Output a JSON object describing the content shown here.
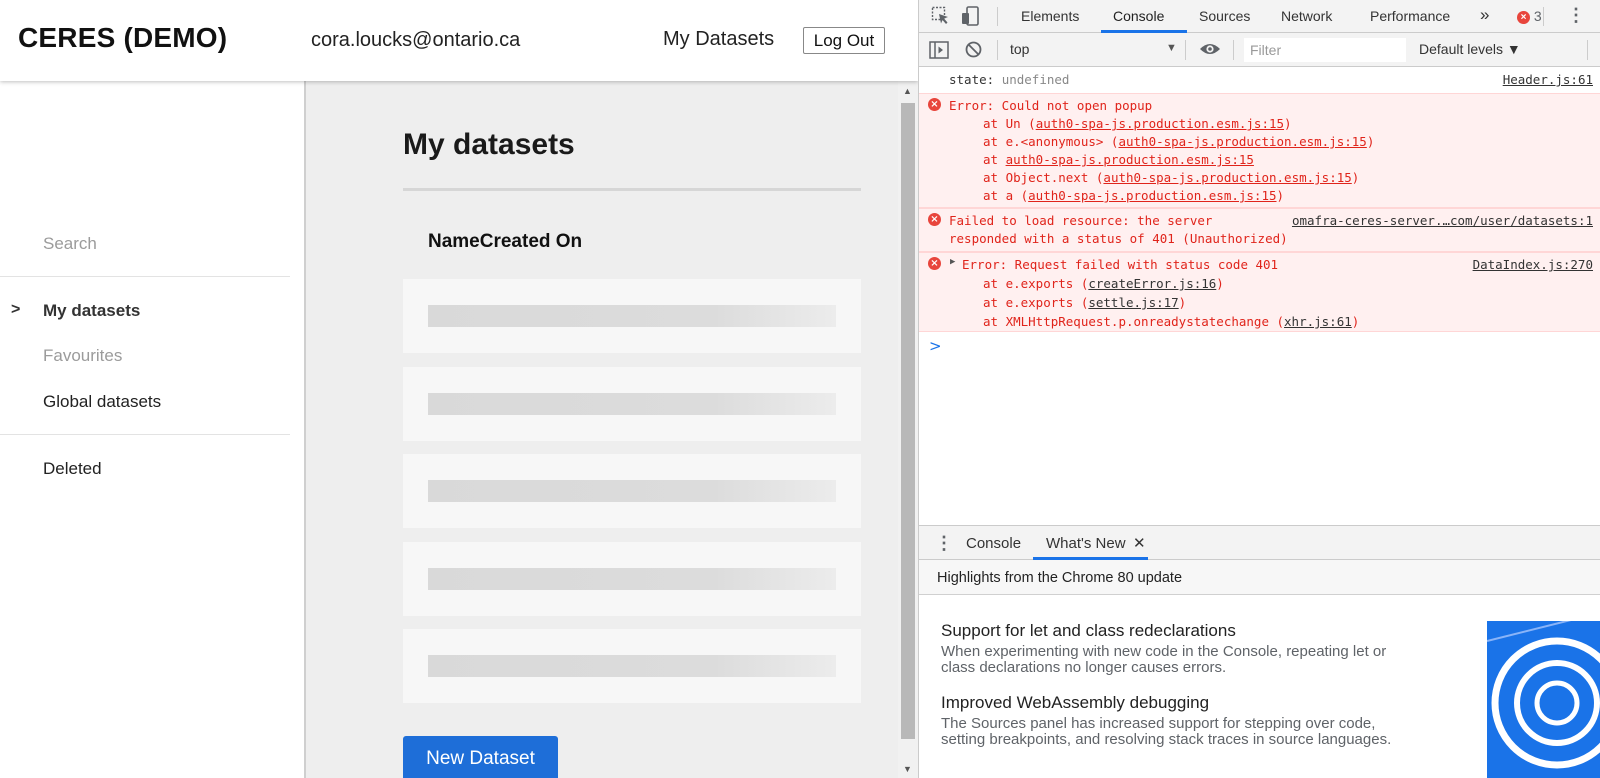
{
  "app": {
    "brand": "CERES (DEMO)",
    "user_email": "cora.loucks@ontario.ca",
    "nav_my_datasets": "My Datasets",
    "logout_label": "Log Out",
    "sidebar": {
      "search_label": "Search",
      "active_marker": ">",
      "items": [
        {
          "label": "My datasets"
        },
        {
          "label": "Favourites"
        },
        {
          "label": "Global datasets"
        },
        {
          "label": "Deleted"
        }
      ]
    },
    "main": {
      "title": "My datasets",
      "table_header": "NameCreated On",
      "new_button_label": "New Dataset"
    },
    "accent_color": "#1e6ed8"
  },
  "devtools": {
    "tabs": [
      "Elements",
      "Console",
      "Sources",
      "Network",
      "Performance"
    ],
    "more_tabs_glyph": "»",
    "error_count": "3",
    "context": "top",
    "filter_placeholder": "Filter",
    "levels_label": "Default levels ▼",
    "console": {
      "state_line": {
        "key": "state:",
        "value": "undefined",
        "source": "Header.js:61"
      },
      "error1": {
        "message": "Error: Could not open popup",
        "stack": [
          {
            "prefix": "at Un (",
            "link": "auth0-spa-js.production.esm.js:15",
            "suffix": ")"
          },
          {
            "prefix": "at e.<anonymous> (",
            "link": "auth0-spa-js.production.esm.js:15",
            "suffix": ")"
          },
          {
            "prefix": "at ",
            "link": "auth0-spa-js.production.esm.js:15",
            "suffix": ""
          },
          {
            "prefix": "at Object.next (",
            "link": "auth0-spa-js.production.esm.js:15",
            "suffix": ")"
          },
          {
            "prefix": "at a (",
            "link": "auth0-spa-js.production.esm.js:15",
            "suffix": ")"
          }
        ]
      },
      "error2": {
        "message": "Failed to load resource: the server",
        "link": "omafra-ceres-server.…com/user/datasets:1",
        "line2": "responded with a status of 401 (Unauthorized)"
      },
      "error3": {
        "message": "Error: Request failed with status code 401",
        "source": "DataIndex.js:270",
        "stack": [
          {
            "prefix": "at e.exports (",
            "link": "createError.js:16",
            "suffix": ")"
          },
          {
            "prefix": "at e.exports (",
            "link": "settle.js:17",
            "suffix": ")"
          },
          {
            "prefix": "at XMLHttpRequest.p.onreadystatechange (",
            "link": "xhr.js:61",
            "suffix": ")"
          }
        ]
      },
      "prompt_glyph": ">"
    },
    "drawer": {
      "tabs": [
        "Console",
        "What's New"
      ],
      "close_glyph": "✕",
      "highlights": "Highlights from the Chrome 80 update",
      "features": [
        {
          "title": "Support for let and class redeclarations",
          "desc": "When experimenting with new code in the Console, repeating let or class declarations no longer causes errors."
        },
        {
          "title": "Improved WebAssembly debugging",
          "desc": "The Sources panel has increased support for stepping over code, setting breakpoints, and resolving stack traces in source languages."
        }
      ]
    },
    "error_color": "#e0241b",
    "link_color": "#1a73e8"
  }
}
